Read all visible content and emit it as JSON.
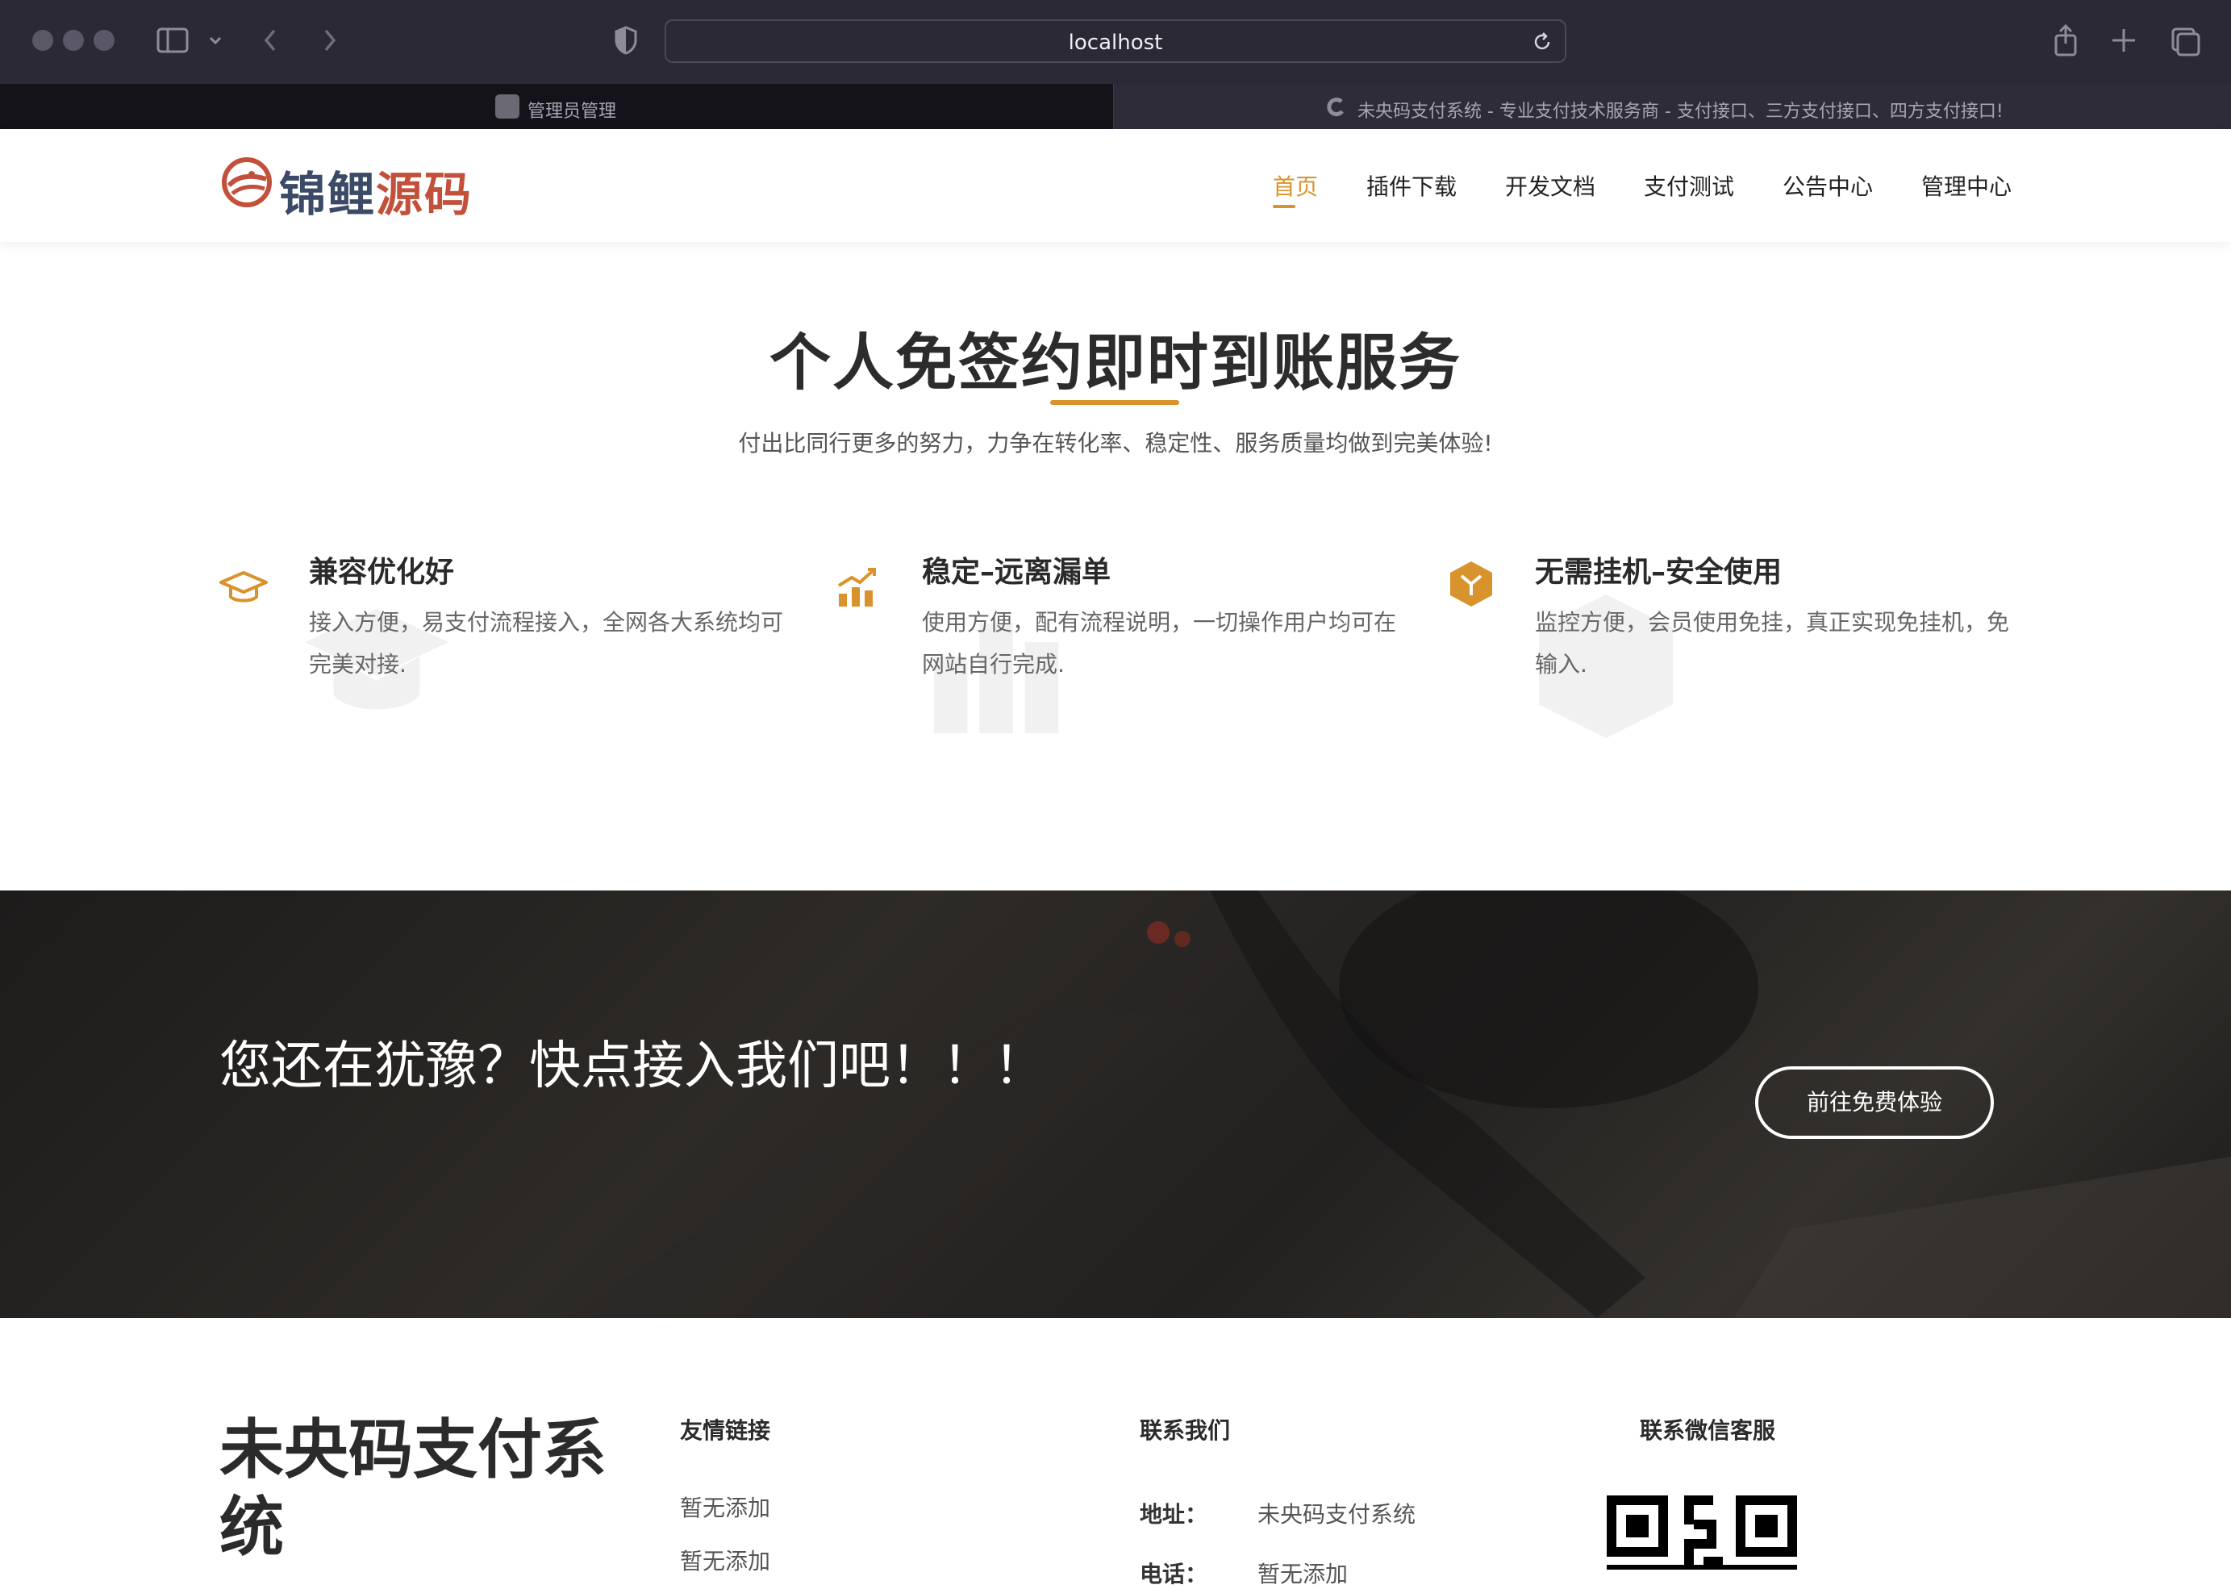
{
  "browser": {
    "address": "localhost",
    "tabs": [
      {
        "label": "管理员管理",
        "active": true
      },
      {
        "label": "未央码支付系统 - 专业支付技术服务商 - 支付接口、三方支付接口、四方支付接口!",
        "active": false
      }
    ],
    "icons": [
      "sidebar-toggle-icon",
      "chevron-down-icon",
      "back-icon",
      "forward-icon",
      "shield-icon",
      "reload-icon",
      "share-icon",
      "new-tab-icon",
      "tab-overview-icon"
    ]
  },
  "header": {
    "logo_part1": "锦鲤",
    "logo_part2": "源码",
    "nav": [
      "首页",
      "插件下载",
      "开发文档",
      "支付测试",
      "公告中心",
      "管理中心"
    ],
    "active_nav": "首页"
  },
  "services": {
    "title": "个人免签约即时到账服务",
    "subtitle": "付出比同行更多的努力，力争在转化率、稳定性、服务质量均做到完美体验!",
    "features": [
      {
        "icon": "graduation-cap-icon",
        "title": "兼容优化好",
        "desc": "接入方便，易支付流程接入，全网各大系统均可完美对接."
      },
      {
        "icon": "bar-chart-icon",
        "title": "稳定–远离漏单",
        "desc": "使用方便，配有流程说明，一切操作用户均可在网站自行完成."
      },
      {
        "icon": "box-icon",
        "title": "无需挂机–安全使用",
        "desc": "监控方便，会员使用免挂，真正实现免挂机，免输入."
      }
    ]
  },
  "cta": {
    "text": "您还在犹豫？快点接入我们吧！！！",
    "button": "前往免费体验"
  },
  "footer": {
    "brand": "未央码支付系统",
    "links_heading": "友情链接",
    "links": [
      "暂无添加",
      "暂无添加"
    ],
    "contact_heading": "联系我们",
    "address_label": "地址：",
    "address_value": "未央码支付系统",
    "phone_label": "电话：",
    "phone_value": "暂无添加",
    "wechat_heading": "联系微信客服"
  },
  "colors": {
    "accent": "#d9932c",
    "logo_dark": "#3b4a66",
    "logo_red": "#c2503a",
    "chrome": "#2b2936"
  }
}
